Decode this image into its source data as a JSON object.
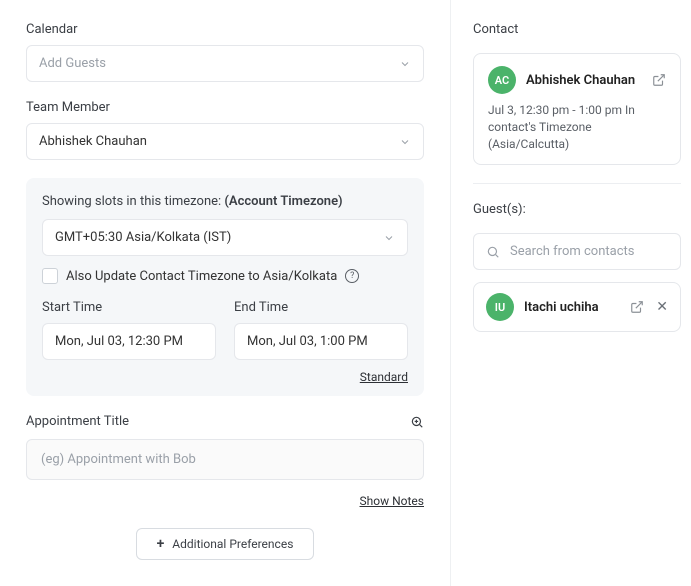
{
  "left": {
    "calendar_label": "Calendar",
    "calendar_placeholder": "Add Guests",
    "team_label": "Team Member",
    "team_value": "Abhishek Chauhan",
    "tz_heading_prefix": "Showing slots in this timezone:",
    "tz_heading_note": "(Account Timezone)",
    "tz_value": "GMT+05:30 Asia/Kolkata (IST)",
    "tz_update_label": "Also Update Contact Timezone to Asia/Kolkata",
    "start_label": "Start Time",
    "start_value": "Mon, Jul 03, 12:30 PM",
    "end_label": "End Time",
    "end_value": "Mon, Jul 03, 1:00 PM",
    "standard_link": "Standard",
    "title_label": "Appointment Title",
    "title_placeholder": "(eg) Appointment with Bob",
    "show_notes": "Show Notes",
    "add_prefs": "Additional Preferences"
  },
  "right": {
    "contact_label": "Contact",
    "contact_initials": "AC",
    "contact_name": "Abhishek Chauhan",
    "contact_sub": "Jul 3, 12:30 pm - 1:00 pm In contact's Timezone (Asia/Calcutta)",
    "guests_label": "Guest(s):",
    "search_placeholder": "Search from contacts",
    "guest_initials": "IU",
    "guest_name": "Itachi uchiha"
  }
}
